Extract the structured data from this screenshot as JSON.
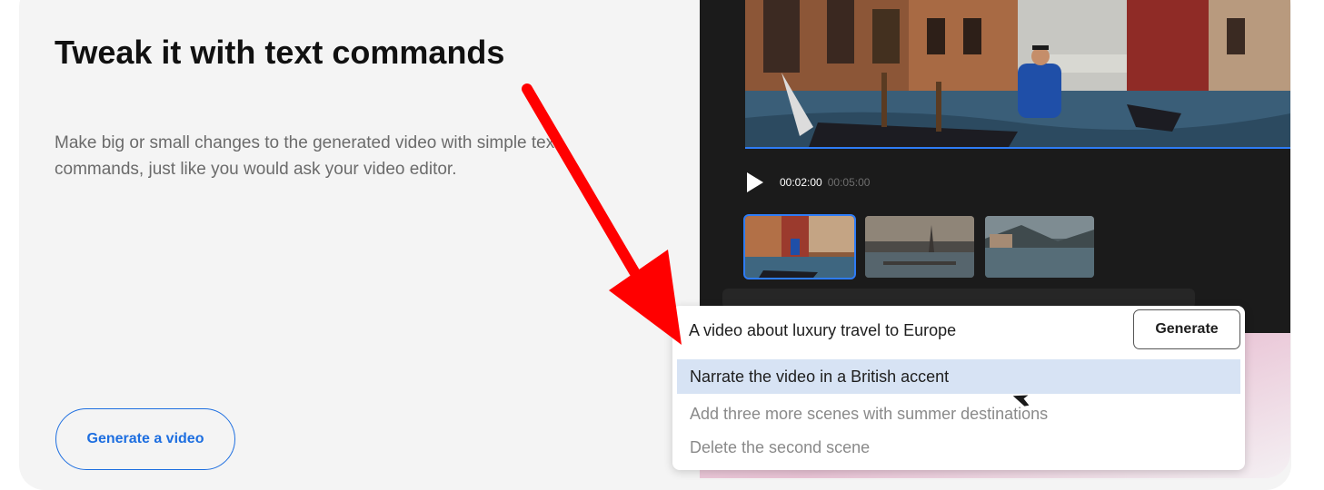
{
  "feature": {
    "title": "Tweak it with text commands",
    "description": "Make big or small changes to the generated video with simple text commands, just like you would ask your video editor.",
    "cta_label": "Generate a video"
  },
  "player": {
    "current_time": "00:02:00",
    "total_time": "00:05:00",
    "scenes": [
      {
        "name": "venice-canal",
        "active": true
      },
      {
        "name": "paris-seine",
        "active": false
      },
      {
        "name": "lake-town",
        "active": false
      }
    ]
  },
  "prompt": {
    "value": "A video about luxury travel to Europe",
    "generate_label": "Generate",
    "suggestions": [
      {
        "label": "Narrate the video in a British accent",
        "selected": true
      },
      {
        "label": "Add three more scenes with summer destinations",
        "selected": false
      },
      {
        "label": "Delete the second scene",
        "selected": false
      }
    ]
  },
  "colors": {
    "accent_blue": "#1d6ee0",
    "annotation_red": "#ff0000",
    "dark_panel": "#1b1b1b",
    "selected_suggestion": "#d7e3f4"
  },
  "icons": [
    "play-icon",
    "mouse-cursor-icon",
    "annotation-arrow-icon"
  ]
}
